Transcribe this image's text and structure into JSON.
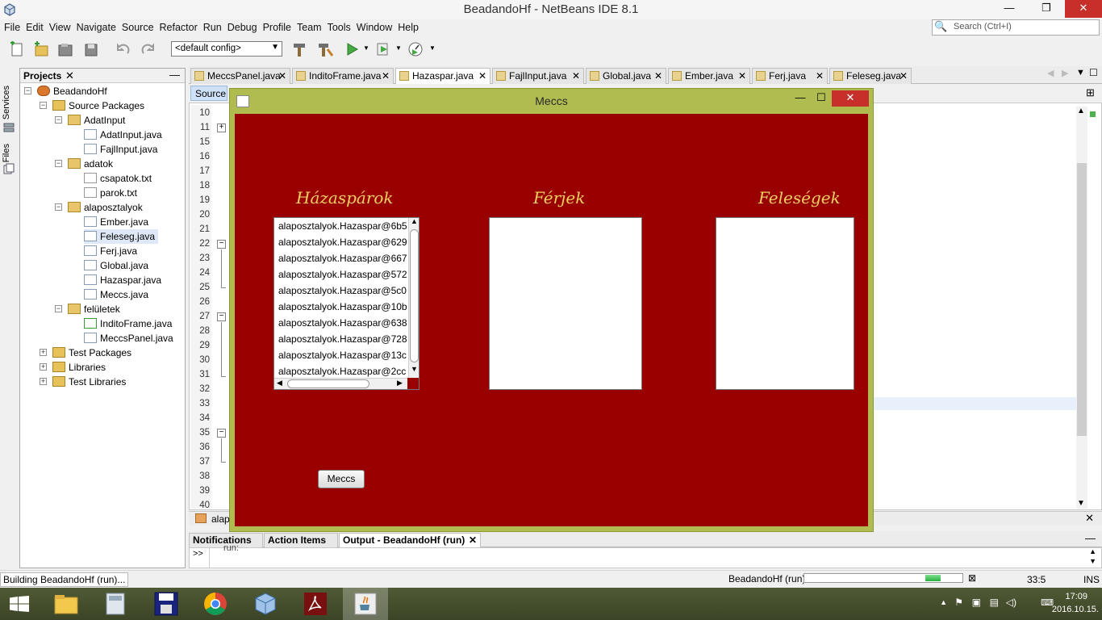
{
  "window": {
    "title": "BeadandoHf - NetBeans IDE 8.1",
    "minimize": "—",
    "maximize": "❐",
    "close": "✕"
  },
  "menu": [
    "File",
    "Edit",
    "View",
    "Navigate",
    "Source",
    "Refactor",
    "Run",
    "Debug",
    "Profile",
    "Team",
    "Tools",
    "Window",
    "Help"
  ],
  "search": {
    "placeholder": "Search (Ctrl+I)"
  },
  "toolbar": {
    "config": "<default config>"
  },
  "sidetabs": {
    "services": "Services",
    "files": "Files"
  },
  "projects": {
    "title": "Projects",
    "close": "✕",
    "minimize": "—",
    "tree": [
      {
        "label": "BeadandoHf"
      },
      {
        "label": "Source Packages"
      },
      {
        "label": "AdatInput"
      },
      {
        "label": "AdatInput.java"
      },
      {
        "label": "FajlInput.java"
      },
      {
        "label": "adatok"
      },
      {
        "label": "csapatok.txt"
      },
      {
        "label": "parok.txt"
      },
      {
        "label": "alaposztalyok"
      },
      {
        "label": "Ember.java"
      },
      {
        "label": "Feleseg.java"
      },
      {
        "label": "Ferj.java"
      },
      {
        "label": "Global.java"
      },
      {
        "label": "Hazaspar.java"
      },
      {
        "label": "Meccs.java"
      },
      {
        "label": "felületek"
      },
      {
        "label": "InditoFrame.java"
      },
      {
        "label": "MeccsPanel.java"
      },
      {
        "label": "Test Packages"
      },
      {
        "label": "Libraries"
      },
      {
        "label": "Test Libraries"
      }
    ]
  },
  "editor": {
    "tabs": [
      {
        "label": "MeccsPanel.java"
      },
      {
        "label": "InditoFrame.java"
      },
      {
        "label": "Hazaspar.java"
      },
      {
        "label": "FajlInput.java"
      },
      {
        "label": "Global.java"
      },
      {
        "label": "Ember.java"
      },
      {
        "label": "Ferj.java"
      },
      {
        "label": "Feleseg.java"
      }
    ],
    "tab_close": "✕",
    "source_tab": "Source",
    "line_numbers": [
      "10",
      "11",
      "15",
      "16",
      "17",
      "18",
      "19",
      "20",
      "21",
      "22",
      "23",
      "24",
      "25",
      "26",
      "27",
      "28",
      "29",
      "30",
      "31",
      "32",
      "33",
      "34",
      "35",
      "36",
      "37",
      "38",
      "39",
      "40"
    ],
    "fold_plus": "+",
    "fold_minus": "−",
    "breadcrumb": "alap",
    "bottom_close": "✕"
  },
  "output": {
    "tabs": [
      "Notifications",
      "Action Items",
      "Output - BeadandoHf (run)"
    ],
    "close": "✕",
    "prompt": ">>",
    "text": "run:"
  },
  "status": {
    "left": "Building BeadandoHf (run)...",
    "task": "BeadandoHf (run)",
    "progress": 0.2,
    "position": "33:5",
    "mode": "INS"
  },
  "clock": {
    "time": "17:09",
    "date": "2016.10.15."
  },
  "meccs": {
    "title": "Meccs",
    "label_hazasparok": "Házaspárok",
    "label_ferjek": "Férjek",
    "label_felesegek": "Feleségek",
    "list_items": [
      "alaposztalyok.Hazaspar@6b5",
      "alaposztalyok.Hazaspar@629",
      "alaposztalyok.Hazaspar@667",
      "alaposztalyok.Hazaspar@572",
      "alaposztalyok.Hazaspar@5c0",
      "alaposztalyok.Hazaspar@10b",
      "alaposztalyok.Hazaspar@638",
      "alaposztalyok.Hazaspar@728",
      "alaposztalyok.Hazaspar@13c",
      "alaposztalyok.Hazaspar@2cc"
    ],
    "button": "Meccs",
    "minimize": "—",
    "maximize": "☐",
    "close": "✕"
  }
}
